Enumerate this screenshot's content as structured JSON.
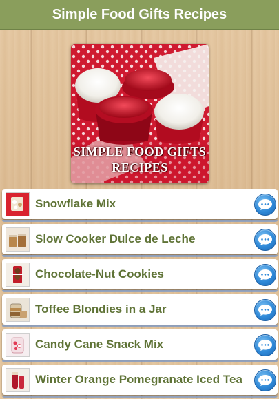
{
  "header": {
    "title": "Simple Food Gifts Recipes"
  },
  "banner": {
    "line1": "SIMPLE FOOD GIFTS",
    "line2": "RECIPES"
  },
  "recipes": [
    {
      "label": "Snowflake Mix",
      "thumb": "snowflake-mix-thumbnail"
    },
    {
      "label": "Slow Cooker Dulce de Leche",
      "thumb": "dulce-de-leche-thumbnail"
    },
    {
      "label": "Chocolate-Nut Cookies",
      "thumb": "chocolate-nut-cookies-thumbnail"
    },
    {
      "label": "Toffee Blondies in a Jar",
      "thumb": "toffee-blondies-thumbnail"
    },
    {
      "label": "Candy Cane Snack Mix",
      "thumb": "candy-cane-snack-mix-thumbnail"
    },
    {
      "label": "Winter Orange Pomegranate Iced Tea",
      "thumb": "iced-tea-thumbnail"
    }
  ],
  "icons": {
    "item_action": "chat-bubble-icon"
  },
  "colors": {
    "header_bg": "#8a9e5c",
    "item_text": "#5f7336",
    "chat_button": "#2f89d8",
    "banner_red": "#c8142a"
  }
}
